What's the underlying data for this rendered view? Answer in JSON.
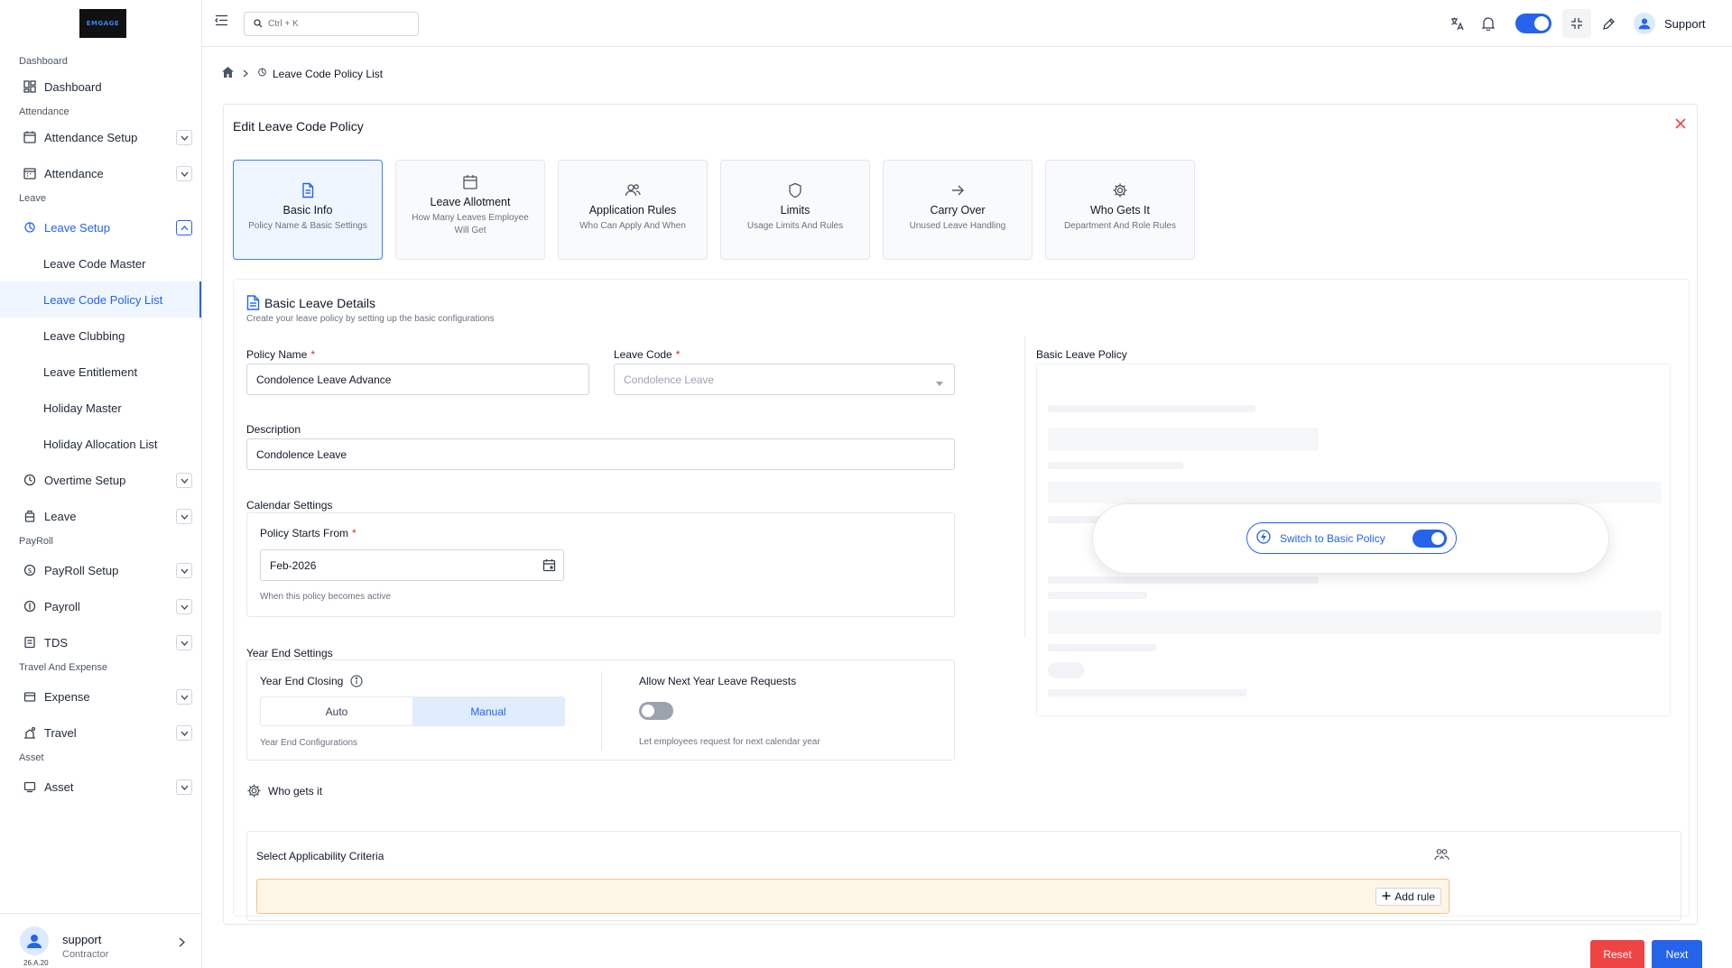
{
  "brand": {
    "logo_text": "EMGAGE"
  },
  "sidebar": {
    "sections": {
      "dashboard": "Dashboard",
      "attendance": "Attendance",
      "leave": "Leave",
      "payroll": "PayRoll",
      "travel": "Travel And Expense",
      "asset": "Asset"
    },
    "items": {
      "dashboard": "Dashboard",
      "attendance_setup": "Attendance Setup",
      "attendance": "Attendance",
      "leave_setup": "Leave Setup",
      "overtime_setup": "Overtime Setup",
      "leave": "Leave",
      "payroll_setup": "PayRoll Setup",
      "payroll": "Payroll",
      "tds": "TDS",
      "expense": "Expense",
      "travel": "Travel",
      "asset": "Asset"
    },
    "leave_subitems": [
      "Leave Code Master",
      "Leave Code Policy List",
      "Leave Clubbing",
      "Leave Entitlement",
      "Holiday Master",
      "Holiday Allocation List"
    ],
    "user": {
      "name": "support",
      "role": "Contractor",
      "version": "26.A.20"
    }
  },
  "topbar": {
    "search_placeholder": "Ctrl + K",
    "user_name": "Support"
  },
  "breadcrumb": {
    "current": "Leave Code Policy List"
  },
  "panel": {
    "title": "Edit Leave Code Policy",
    "steps": [
      {
        "title": "Basic Info",
        "subtitle": "Policy Name & Basic Settings"
      },
      {
        "title": "Leave Allotment",
        "subtitle": "How Many Leaves Employee Will Get"
      },
      {
        "title": "Application Rules",
        "subtitle": "Who Can Apply And When"
      },
      {
        "title": "Limits",
        "subtitle": "Usage Limits And Rules"
      },
      {
        "title": "Carry Over",
        "subtitle": "Unused Leave Handling"
      },
      {
        "title": "Who Gets It",
        "subtitle": "Department And Role Rules"
      }
    ]
  },
  "basic": {
    "title": "Basic Leave Details",
    "subtitle": "Create your leave policy by setting up the basic configurations",
    "policy_name_label": "Policy Name",
    "policy_name_value": "Condolence Leave Advance",
    "leave_code_label": "Leave Code",
    "leave_code_value": "Condolence Leave",
    "description_label": "Description",
    "description_value": "Condolence Leave",
    "required_mark": "*",
    "calendar_title": "Calendar Settings",
    "starts_from_label": "Policy Starts From",
    "starts_from_value": "Feb-2026",
    "starts_from_hint": "When this policy becomes active",
    "year_end_title": "Year End Settings",
    "year_end_closing_label": "Year End Closing",
    "year_end_options": [
      "Auto",
      "Manual"
    ],
    "year_end_selected": "Manual",
    "year_end_hint": "Year End Configurations",
    "allow_next_label": "Allow Next Year Leave Requests",
    "allow_next_hint": "Let employees request for next calendar year",
    "allow_next_enabled": false
  },
  "policy_preview": {
    "title": "Basic Leave Policy",
    "switch_label": "Switch to Basic Policy",
    "switch_enabled": true
  },
  "who_gets_it": {
    "title": "Who gets it",
    "criteria_title": "Select Applicability Criteria",
    "add_rule_label": "Add rule"
  },
  "actions": {
    "reset_label": "Reset",
    "next_label": "Next"
  },
  "colors": {
    "primary": "#2563eb",
    "danger": "#ef4444",
    "rule_bg": "#fdf5e6"
  }
}
